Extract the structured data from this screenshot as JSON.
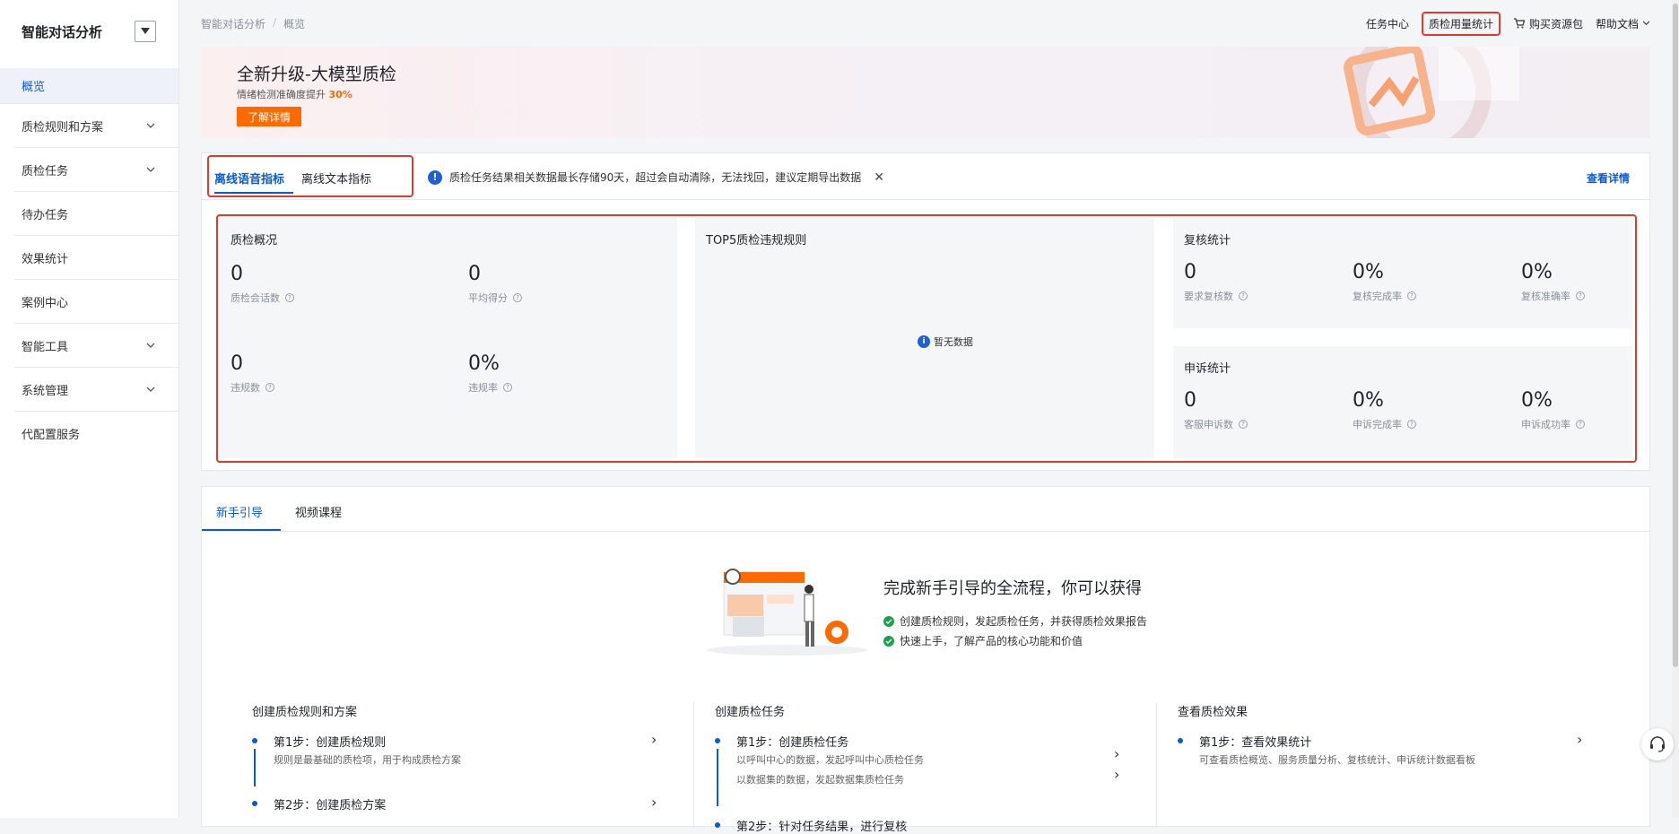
{
  "sidebar": {
    "title": "智能对话分析",
    "items": [
      {
        "label": "概览",
        "active": true,
        "expandable": false
      },
      {
        "label": "质检规则和方案",
        "active": false,
        "expandable": true
      },
      {
        "label": "质检任务",
        "active": false,
        "expandable": true
      },
      {
        "label": "待办任务",
        "active": false,
        "expandable": false
      },
      {
        "label": "效果统计",
        "active": false,
        "expandable": false
      },
      {
        "label": "案例中心",
        "active": false,
        "expandable": false
      },
      {
        "label": "智能工具",
        "active": false,
        "expandable": true
      },
      {
        "label": "系统管理",
        "active": false,
        "expandable": true
      },
      {
        "label": "代配置服务",
        "active": false,
        "expandable": false
      }
    ]
  },
  "breadcrumb": [
    "智能对话分析",
    "/",
    "概览"
  ],
  "top_links": [
    "任务中心",
    "质检用量统计",
    "购买资源包",
    "帮助文档"
  ],
  "banner": {
    "title": "全新升级-大模型质检",
    "subtitle_prefix": "情绪检测准确度提升",
    "subtitle_value": "30%",
    "button": "了解详情"
  },
  "overview_card": {
    "tabs": [
      "离线语音指标",
      "离线文本指标"
    ],
    "notice": "质检任务结果相关数据最长存储90天，超过会自动清除，无法找回，建议定期导出数据",
    "detail_link": "查看详情",
    "qc_overview": {
      "title": "质检概况",
      "metrics": [
        {
          "value": "0",
          "label": "质检会话数"
        },
        {
          "value": "0",
          "label": "平均得分"
        },
        {
          "value": "0",
          "label": "违规数"
        },
        {
          "value": "0%",
          "label": "违规率"
        }
      ]
    },
    "top5": {
      "title": "TOP5质检违规规则",
      "empty": "暂无数据"
    },
    "review": {
      "title": "复核统计",
      "metrics": [
        {
          "value": "0",
          "label": "要求复核数"
        },
        {
          "value": "0%",
          "label": "复核完成率"
        },
        {
          "value": "0%",
          "label": "复核准确率"
        }
      ]
    },
    "appeal": {
      "title": "申诉统计",
      "metrics": [
        {
          "value": "0",
          "label": "客服申诉数"
        },
        {
          "value": "0%",
          "label": "申诉完成率"
        },
        {
          "value": "0%",
          "label": "申诉成功率"
        }
      ]
    }
  },
  "guide_card": {
    "tabs": [
      "新手引导",
      "视频课程"
    ],
    "heading": "完成新手引导的全流程，你可以获得",
    "checks": [
      "创建质检规则，发起质检任务，并获得质检效果报告",
      "快速上手，了解产品的核心功能和价值"
    ],
    "columns": [
      {
        "title": "创建质检规则和方案",
        "steps": [
          {
            "title": "第1步：创建质检规则",
            "desc": [
              "规则是最基础的质检项，用于构成质检方案"
            ]
          },
          {
            "title": "第2步：创建质检方案",
            "desc": []
          }
        ]
      },
      {
        "title": "创建质检任务",
        "steps": [
          {
            "title": "第1步：创建质检任务",
            "desc": [
              "以呼叫中心的数据，发起呼叫中心质检任务",
              "以数据集的数据，发起数据集质检任务"
            ]
          },
          {
            "title": "第2步：针对任务结果，进行复核",
            "desc": []
          }
        ]
      },
      {
        "title": "查看质检效果",
        "steps": [
          {
            "title": "第1步：查看效果统计",
            "desc": [
              "可查看质检概览、服务质量分析、复核统计、申诉统计数据看板"
            ]
          }
        ]
      }
    ]
  },
  "colors": {
    "primary": "#0a5bd3",
    "accent": "#ff6a00",
    "highlight": "#e03a2e",
    "success": "#1aa34a"
  }
}
